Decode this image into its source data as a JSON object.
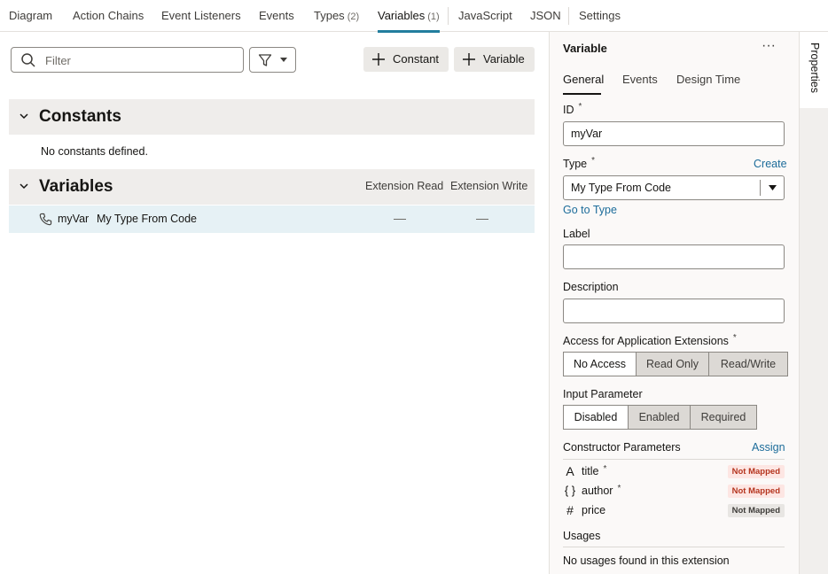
{
  "tabs": [
    {
      "label": "Diagram"
    },
    {
      "label": "Action Chains"
    },
    {
      "label": "Event Listeners"
    },
    {
      "label": "Events"
    },
    {
      "label": "Types",
      "count": "(2)"
    },
    {
      "label": "Variables",
      "count": "(1)"
    },
    {
      "label": "JavaScript"
    },
    {
      "label": "JSON"
    },
    {
      "label": "Settings"
    }
  ],
  "toolbar": {
    "filter_placeholder": "Filter",
    "constant_label": "Constant",
    "variable_label": "Variable"
  },
  "constants": {
    "title": "Constants",
    "empty_message": "No constants defined."
  },
  "variables": {
    "title": "Variables",
    "col_read": "Extension Read",
    "col_write": "Extension Write",
    "rows": [
      {
        "name": "myVar",
        "type": "My Type From Code",
        "read": "—",
        "write": "—"
      }
    ]
  },
  "panel": {
    "title": "Variable",
    "tabs": [
      "General",
      "Events",
      "Design Time"
    ],
    "id_label": "ID",
    "id_value": "myVar",
    "required_mark": "*",
    "type_label": "Type",
    "create_link": "Create",
    "type_value": "My Type From Code",
    "goto_type_link": "Go to Type",
    "label_label": "Label",
    "label_value": "",
    "description_label": "Description",
    "description_value": "",
    "access_label": "Access for Application Extensions",
    "access_options": [
      "No Access",
      "Read Only",
      "Read/Write"
    ],
    "access_selected": "No Access",
    "input_param_label": "Input Parameter",
    "input_param_options": [
      "Disabled",
      "Enabled",
      "Required"
    ],
    "input_param_selected": "Disabled",
    "ctor_label": "Constructor Parameters",
    "assign_link": "Assign",
    "ctor_params": [
      {
        "name": "title",
        "required": true,
        "status": "Not Mapped",
        "icon": "string-type-icon",
        "glyph": "A"
      },
      {
        "name": "author",
        "required": true,
        "status": "Not Mapped",
        "icon": "object-type-icon",
        "glyph": "{ }"
      },
      {
        "name": "price",
        "required": false,
        "status": "Not Mapped",
        "icon": "number-type-icon",
        "glyph": "#"
      }
    ],
    "usages_label": "Usages",
    "usages_message": "No usages found in this extension"
  },
  "side_tab": {
    "label": "Properties"
  },
  "colors": {
    "accent": "#227e9e",
    "selected_row": "#e6f1f5",
    "not_mapped_red": "#b5351f",
    "link": "#1c6c9a"
  }
}
